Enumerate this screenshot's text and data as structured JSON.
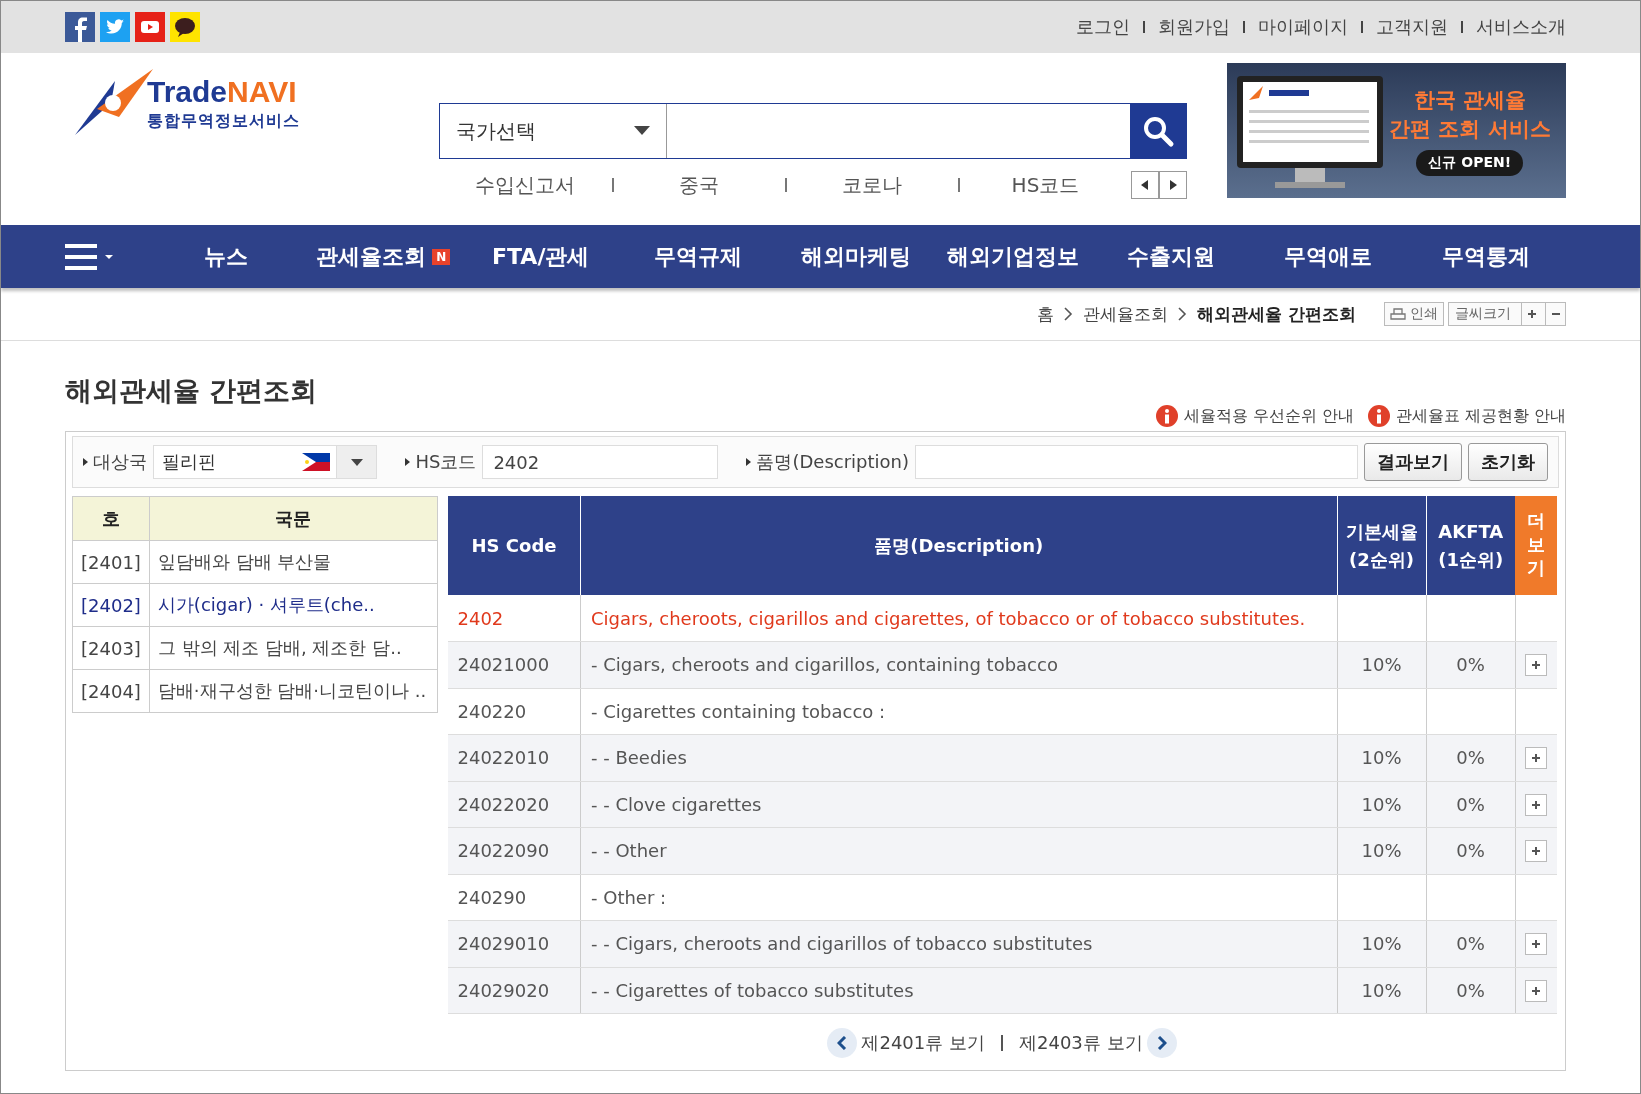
{
  "top_links": [
    "로그인",
    "회원가입",
    "마이페이지",
    "고객지원",
    "서비스소개"
  ],
  "logo": {
    "title_parts": [
      "Trade",
      "NAVI"
    ],
    "subtitle": "통합무역정보서비스"
  },
  "search": {
    "country_select": "국가선택"
  },
  "quick_links": [
    "수입신고서",
    "중국",
    "코로나",
    "HS코드"
  ],
  "banner": {
    "lines": [
      "한국 관세율",
      "간편 조회 서비스"
    ],
    "badge": "신규 OPEN!"
  },
  "nav": {
    "items": [
      {
        "label": "뉴스"
      },
      {
        "label": "관세율조회",
        "badge": "N"
      },
      {
        "label": "FTA/관세"
      },
      {
        "label": "무역규제"
      },
      {
        "label": "해외마케팅"
      },
      {
        "label": "해외기업정보"
      },
      {
        "label": "수출지원"
      },
      {
        "label": "무역애로"
      },
      {
        "label": "무역통계"
      }
    ]
  },
  "breadcrumb": [
    "홈",
    "관세율조회",
    "해외관세율 간편조회"
  ],
  "tools": {
    "print": "인쇄",
    "font_size": "글씨크기"
  },
  "page_title": "해외관세율 간편조회",
  "info_links": [
    "세율적용 우선순위 안내",
    "관세율표 제공현황 안내"
  ],
  "filter": {
    "country_label": "대상국",
    "country": "필리핀",
    "hs_label": "HS코드",
    "hs_value": "2402",
    "desc_label": "품명(Description)",
    "buttons": [
      "결과보기",
      "초기화"
    ]
  },
  "headings_table": {
    "columns": [
      "호",
      "국문"
    ],
    "rows": [
      {
        "code": "[2401]",
        "name": "잎담배와 담배 부산물",
        "selected": false
      },
      {
        "code": "[2402]",
        "name": "시가(cigar) · 셔루트(che..",
        "selected": true
      },
      {
        "code": "[2403]",
        "name": "그 밖의 제조 담배, 제조한 담..",
        "selected": false
      },
      {
        "code": "[2404]",
        "name": "담배·재구성한 담배·니코틴이나 ..",
        "selected": false
      }
    ]
  },
  "tariff_table": {
    "columns": [
      {
        "kind": "normal",
        "lines": [
          "HS Code"
        ]
      },
      {
        "kind": "normal",
        "lines": [
          "품명(Description)"
        ]
      },
      {
        "kind": "normal",
        "lines": [
          "기본세율",
          "(2순위)"
        ]
      },
      {
        "kind": "normal",
        "lines": [
          "AKFTA",
          "(1순위)"
        ]
      },
      {
        "kind": "more",
        "lines": [
          "더보기"
        ]
      }
    ],
    "rows": [
      {
        "kind": "heading",
        "code": "2402",
        "description": "Cigars, cheroots, cigarillos and cigarettes, of tobacco or of tobacco substitutes."
      },
      {
        "kind": "item",
        "code": "24021000",
        "description": "- Cigars, cheroots and cigarillos, containing tobacco",
        "basic": "10%",
        "akfta": "0%"
      },
      {
        "kind": "sub",
        "code": "240220",
        "description": "- Cigarettes containing tobacco :"
      },
      {
        "kind": "item",
        "code": "24022010",
        "description": "- - Beedies",
        "basic": "10%",
        "akfta": "0%"
      },
      {
        "kind": "item",
        "code": "24022020",
        "description": "- - Clove cigarettes",
        "basic": "10%",
        "akfta": "0%"
      },
      {
        "kind": "item",
        "code": "24022090",
        "description": "- - Other",
        "basic": "10%",
        "akfta": "0%"
      },
      {
        "kind": "sub",
        "code": "240290",
        "description": "- Other :"
      },
      {
        "kind": "item",
        "code": "24029010",
        "description": "- - Cigars, cheroots and cigarillos of tobacco substitutes",
        "basic": "10%",
        "akfta": "0%"
      },
      {
        "kind": "item",
        "code": "24029020",
        "description": "- - Cigarettes of tobacco substitutes",
        "basic": "10%",
        "akfta": "0%"
      }
    ]
  },
  "pager": {
    "prev": "제2401류 보기",
    "next": "제2403류 보기"
  }
}
